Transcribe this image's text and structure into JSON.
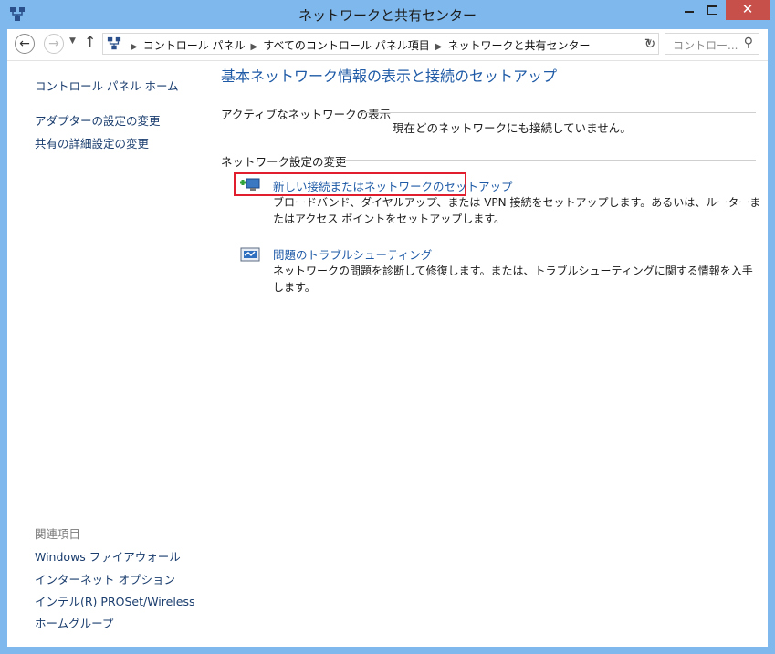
{
  "window": {
    "title": "ネットワークと共有センター",
    "close_glyph": "✕"
  },
  "nav": {
    "back_glyph": "←",
    "forward_glyph": "→",
    "up_glyph": "↑",
    "breadcrumbs": [
      "コントロール パネル",
      "すべてのコントロール パネル項目",
      "ネットワークと共有センター"
    ],
    "refresh_glyph": "↻",
    "search_placeholder": "コントロー...",
    "search_glyph": "⚲"
  },
  "sidebar": {
    "home": "コントロール パネル ホーム",
    "links": [
      "アダプターの設定の変更",
      "共有の詳細設定の変更"
    ],
    "related_heading": "関連項目",
    "related": [
      "Windows ファイアウォール",
      "インターネット オプション",
      "インテル(R) PROSet/Wireless",
      "ホームグループ"
    ]
  },
  "main": {
    "title": "基本ネットワーク情報の表示と接続のセットアップ",
    "active_section": "アクティブなネットワークの表示",
    "active_status": "現在どのネットワークにも接続していません。",
    "change_section": "ネットワーク設定の変更",
    "tasks": [
      {
        "link": "新しい接続またはネットワークのセットアップ",
        "desc": "ブロードバンド、ダイヤルアップ、または VPN 接続をセットアップします。あるいは、ルーターまたはアクセス ポイントをセットアップします。"
      },
      {
        "link": "問題のトラブルシューティング",
        "desc": "ネットワークの問題を診断して修復します。または、トラブルシューティングに関する情報を入手します。"
      }
    ]
  },
  "colors": {
    "frame": "#7fb8ec",
    "link": "#1e5aa6",
    "highlight": "#e01e2e",
    "close": "#c7504b"
  }
}
